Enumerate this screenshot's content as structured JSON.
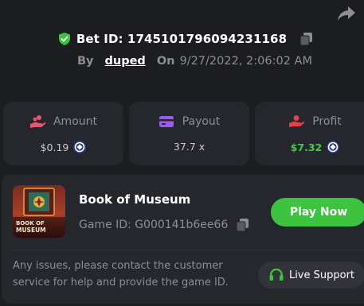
{
  "bet": {
    "label": "Bet ID: 1745101796094231168",
    "by_label": "By",
    "username": "duped",
    "on_label": "On",
    "date": "9/27/2022, 2:06:02 AM"
  },
  "stats": {
    "amount": {
      "label": "Amount",
      "value": "$0.19",
      "icon": "coins-hand-icon",
      "color": "#f0536b"
    },
    "payout": {
      "label": "Payout",
      "value": "37.7 x",
      "icon": "card-icon",
      "color": "#9a5cf0"
    },
    "profit": {
      "label": "Profit",
      "value": "$7.32",
      "icon": "hand-coin-icon",
      "color": "#e8404b"
    }
  },
  "game": {
    "name": "Book of Museum",
    "id_label": "Game ID: G000141b6ee66",
    "thumb_text": "BOOK OF MUSEUM",
    "play_label": "Play Now",
    "notice": "Any issues, please contact the customer service for help and provide the game ID.",
    "support_label": "Live Support"
  },
  "colors": {
    "accent_green": "#3dc33f",
    "profit_green": "#43cc4a",
    "background": "#1c1d21",
    "card": "#26272d",
    "muted_text": "#8d8e97"
  },
  "icons": [
    "share-icon",
    "shield-check-icon",
    "copy-icon",
    "coin-icon",
    "headset-icon"
  ]
}
